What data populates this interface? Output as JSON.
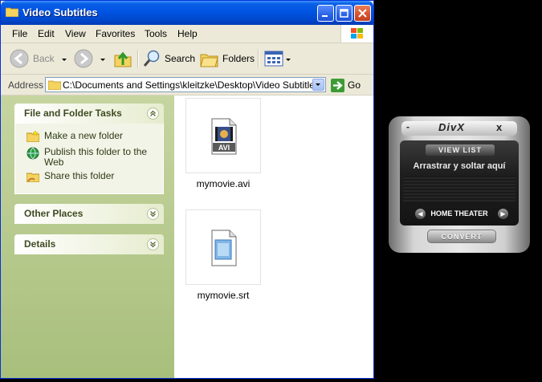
{
  "window": {
    "title": "Video Subtitles"
  },
  "menu": [
    "File",
    "Edit",
    "View",
    "Favorites",
    "Tools",
    "Help"
  ],
  "toolbar": {
    "back_label": "Back",
    "search_label": "Search",
    "folders_label": "Folders"
  },
  "address": {
    "label": "Address",
    "path": "C:\\Documents and Settings\\kleitzke\\Desktop\\Video Subtitles",
    "go_label": "Go"
  },
  "tasks": {
    "file_folder": {
      "title": "File and Folder Tasks",
      "items": [
        "Make a new folder",
        "Publish this folder to the Web",
        "Share this folder"
      ]
    },
    "other_places": {
      "title": "Other Places"
    },
    "details": {
      "title": "Details"
    }
  },
  "files": [
    {
      "name": "mymovie.avi",
      "icon": "avi-video-file-icon",
      "badge": "AVI"
    },
    {
      "name": "mymovie.srt",
      "icon": "generic-file-icon"
    }
  ],
  "divx": {
    "logo": "DivX",
    "minimize": "-",
    "close": "x",
    "view_list": "VIEW LIST",
    "drop_text": "Arrastrar y soltar aquí",
    "profile": "HOME THEATER",
    "prev": "◀",
    "next": "▶",
    "convert": "CONVERT"
  },
  "colors": {
    "titlebar": "#0054e3",
    "taskpane": "#b5c98c",
    "desktop": "#000000"
  }
}
